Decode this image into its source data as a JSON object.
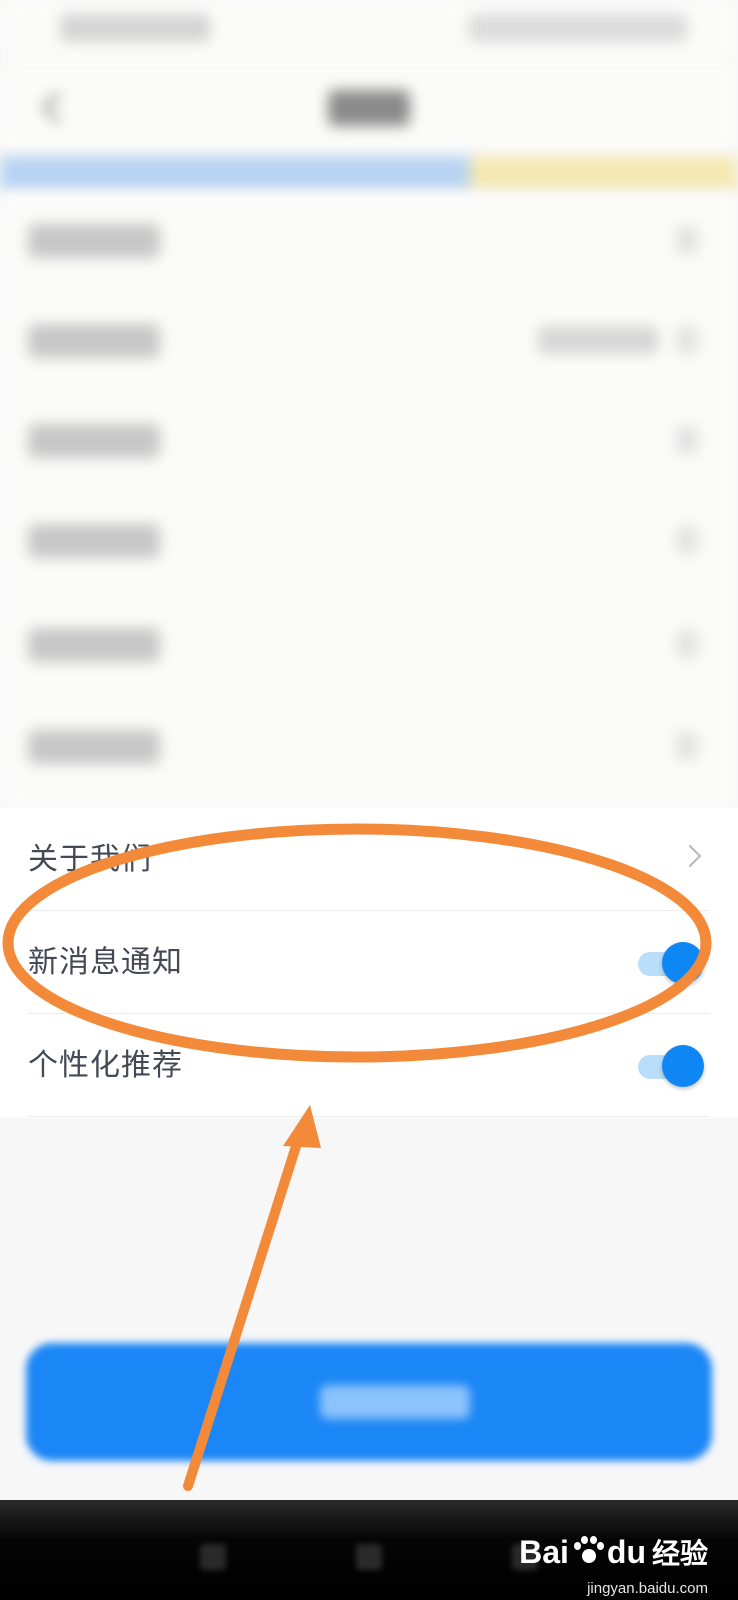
{
  "settings": {
    "rows": [
      {
        "label": "关于我们",
        "control": "chevron"
      },
      {
        "label": "新消息通知",
        "control": "toggle",
        "on": true
      },
      {
        "label": "个性化推荐",
        "control": "toggle",
        "on": true
      }
    ]
  },
  "colors": {
    "accent": "#0e87f5",
    "annotation": "#f28a3a"
  },
  "watermark": {
    "brand_prefix": "Bai",
    "brand_suffix": "du",
    "brand_cn": "经验",
    "url": "jingyan.baidu.com"
  },
  "icons": [
    "back-icon",
    "chevron-right-icon",
    "toggle-switch",
    "paw-icon"
  ]
}
